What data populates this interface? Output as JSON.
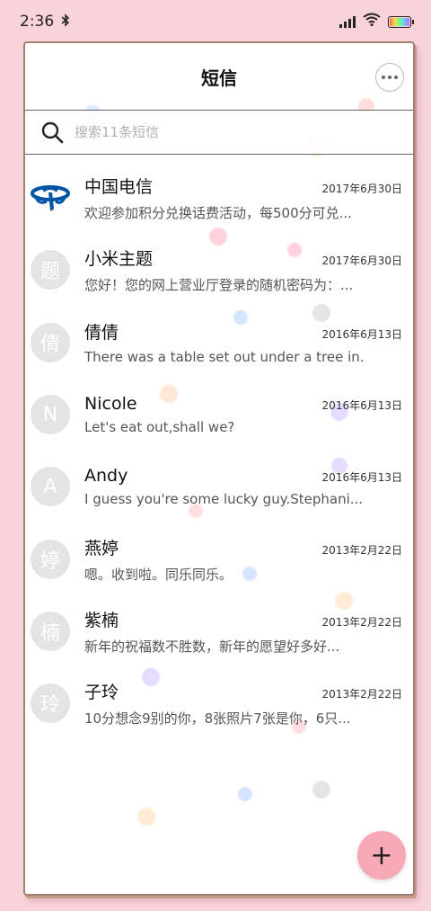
{
  "status_bar": {
    "time": "2:36",
    "bluetooth_icon": "bluetooth-icon",
    "signal_icon": "signal-icon",
    "wifi_icon": "wifi-icon",
    "battery_icon": "battery-icon"
  },
  "header": {
    "title": "短信",
    "more_icon": "more-dots-icon"
  },
  "search": {
    "placeholder": "搜索11条短信",
    "icon": "search-icon"
  },
  "messages": [
    {
      "avatar": "",
      "avatar_type": "china-telecom-logo",
      "name": "中国电信",
      "date": "2017年6月30日",
      "preview": "欢迎参加积分兑换话费活动，每500分可兑..."
    },
    {
      "avatar": "题",
      "name": "小米主题",
      "date": "2017年6月30日",
      "preview": "您好！您的网上营业厅登录的随机密码为：..."
    },
    {
      "avatar": "倩",
      "name": "倩倩",
      "date": "2016年6月13日",
      "preview": "There was a table set out under a tree in..."
    },
    {
      "avatar": "N",
      "name": "Nicole",
      "date": "2016年6月13日",
      "preview": "Let's eat out,shall we?"
    },
    {
      "avatar": "A",
      "name": "Andy",
      "date": "2016年6月13日",
      "preview": "I guess you're some lucky guy.Stephani..."
    },
    {
      "avatar": "婷",
      "name": "燕婷",
      "date": "2013年2月22日",
      "preview": "嗯。收到啦。同乐同乐。"
    },
    {
      "avatar": "楠",
      "name": "紫楠",
      "date": "2013年2月22日",
      "preview": "新年的祝福数不胜数，新年的愿望好多好..."
    },
    {
      "avatar": "玲",
      "name": "子玲",
      "date": "2013年2月22日",
      "preview": "10分想念9别的你，8张照片7张是你，6只..."
    }
  ],
  "fab": {
    "label": "+",
    "icon": "plus-icon"
  },
  "colors": {
    "background": "#f8d3da",
    "fab": "#f7a9b8",
    "avatar": "#e4e4e4",
    "telecom_blue": "#0055a5"
  }
}
